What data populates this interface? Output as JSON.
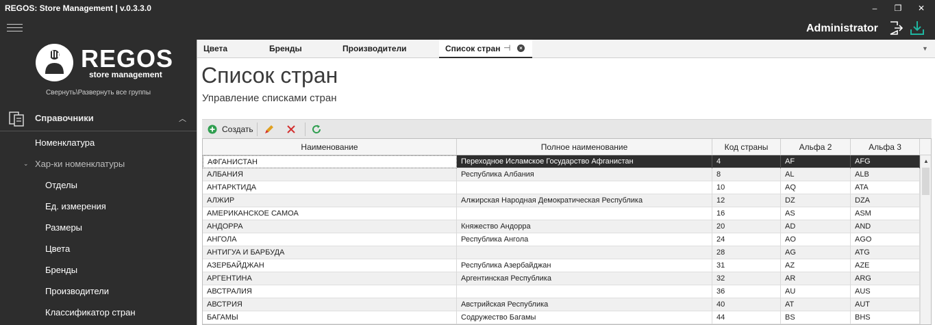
{
  "window": {
    "title": "REGOS: Store Management | v.0.3.3.0",
    "minimize": "–",
    "restore": "❐",
    "close": "✕"
  },
  "header": {
    "user": "Administrator",
    "icons": [
      "logout-icon",
      "download-icon"
    ],
    "accent": "#1fb5a0"
  },
  "sidebar": {
    "logo_text": "REGOS",
    "logo_sub": "store management",
    "collapse_label": "Свернуть\\Развернуть все группы",
    "section": {
      "label": "Справочники",
      "icon": "directory-icon"
    },
    "items": [
      {
        "label": "Номенклатура",
        "level": 1
      },
      {
        "label": "Хар-ки номенклатуры",
        "level": 1,
        "expanded": true
      },
      {
        "label": "Отделы",
        "level": 2
      },
      {
        "label": "Ед. измерения",
        "level": 2
      },
      {
        "label": "Размеры",
        "level": 2
      },
      {
        "label": "Цвета",
        "level": 2
      },
      {
        "label": "Бренды",
        "level": 2
      },
      {
        "label": "Производители",
        "level": 2
      },
      {
        "label": "Классификатор стран",
        "level": 2
      }
    ]
  },
  "tabs": [
    {
      "label": "Цвета"
    },
    {
      "label": "Бренды"
    },
    {
      "label": "Производители"
    },
    {
      "label": "Список стран",
      "active": true
    }
  ],
  "page": {
    "title": "Список стран",
    "subtitle": "Управление списками стран"
  },
  "toolbar": {
    "create_label": "Создать",
    "colors": {
      "create": "#2e9e4f",
      "edit": "#e0a020",
      "delete": "#d32f2f",
      "refresh": "#2e9e4f"
    }
  },
  "grid": {
    "columns": [
      "Наименование",
      "Полное наименование",
      "Код страны",
      "Альфа 2",
      "Альфа 3"
    ],
    "rows": [
      [
        "АФГАНИСТАН",
        "Переходное Исламское Государство Афганистан",
        "4",
        "AF",
        "AFG"
      ],
      [
        "АЛБАНИЯ",
        "Республика Албания",
        "8",
        "AL",
        "ALB"
      ],
      [
        "АНТАРКТИДА",
        "",
        "10",
        "AQ",
        "ATA"
      ],
      [
        "АЛЖИР",
        "Алжирская Народная Демократическая Республика",
        "12",
        "DZ",
        "DZA"
      ],
      [
        "АМЕРИКАНСКОЕ САМОА",
        "",
        "16",
        "AS",
        "ASM"
      ],
      [
        "АНДОРРА",
        "Княжество Андорра",
        "20",
        "AD",
        "AND"
      ],
      [
        "АНГОЛА",
        "Республика Ангола",
        "24",
        "AO",
        "AGO"
      ],
      [
        "АНТИГУА И БАРБУДА",
        "",
        "28",
        "AG",
        "ATG"
      ],
      [
        "АЗЕРБАЙДЖАН",
        "Республика Азербайджан",
        "31",
        "AZ",
        "AZE"
      ],
      [
        "АРГЕНТИНА",
        "Аргентинская Республика",
        "32",
        "AR",
        "ARG"
      ],
      [
        "АВСТРАЛИЯ",
        "",
        "36",
        "AU",
        "AUS"
      ],
      [
        "АВСТРИЯ",
        "Австрийская Республика",
        "40",
        "AT",
        "AUT"
      ],
      [
        "БАГАМЫ",
        "Содружество Багамы",
        "44",
        "BS",
        "BHS"
      ]
    ],
    "selected_row": 0
  }
}
